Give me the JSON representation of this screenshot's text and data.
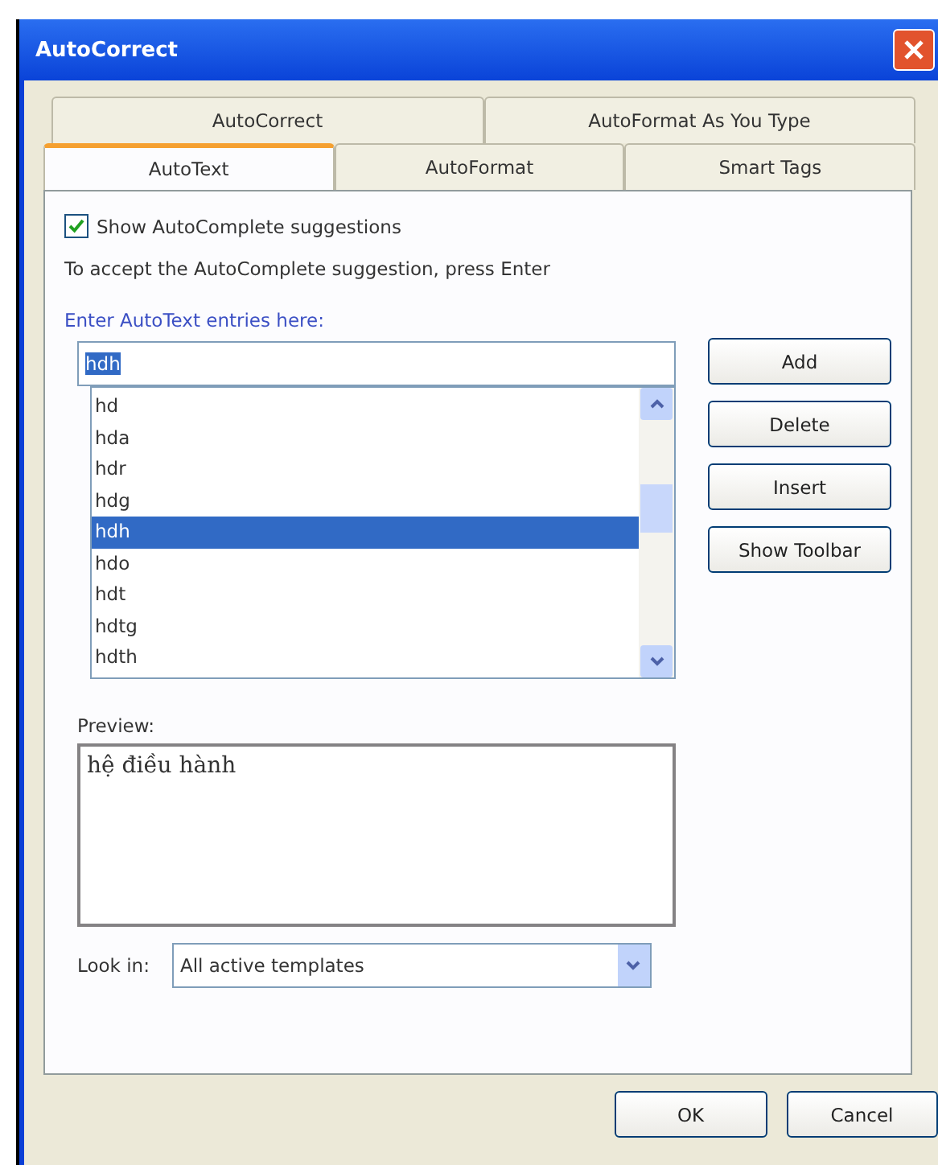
{
  "window": {
    "title": "AutoCorrect"
  },
  "tab_rows": [
    {
      "tabs": [
        {
          "label": "AutoCorrect",
          "selected": false
        },
        {
          "label": "AutoFormat As You Type",
          "selected": false
        }
      ]
    },
    {
      "tabs": [
        {
          "label": "AutoText",
          "selected": true
        },
        {
          "label": "AutoFormat",
          "selected": false
        },
        {
          "label": "Smart Tags",
          "selected": false
        }
      ]
    }
  ],
  "show_autocomplete": {
    "label": "Show AutoComplete suggestions",
    "checked": true
  },
  "hint": "To accept the AutoComplete suggestion, press Enter",
  "entries_label": "Enter AutoText entries here:",
  "entry_field": {
    "value": "hdh"
  },
  "entries": [
    {
      "label": "hd",
      "selected": false
    },
    {
      "label": "hda",
      "selected": false
    },
    {
      "label": "hdr",
      "selected": false
    },
    {
      "label": "hdg",
      "selected": false
    },
    {
      "label": "hdh",
      "selected": true
    },
    {
      "label": "hdo",
      "selected": false
    },
    {
      "label": "hdt",
      "selected": false
    },
    {
      "label": "hdtg",
      "selected": false
    },
    {
      "label": "hdth",
      "selected": false
    }
  ],
  "side_buttons": [
    "Add",
    "Delete",
    "Insert",
    "Show Toolbar"
  ],
  "preview": {
    "label": "Preview:",
    "text": "hệ điều hành"
  },
  "look_in": {
    "label": "Look in:",
    "value": "All active templates"
  },
  "buttons": [
    "OK",
    "Cancel"
  ]
}
